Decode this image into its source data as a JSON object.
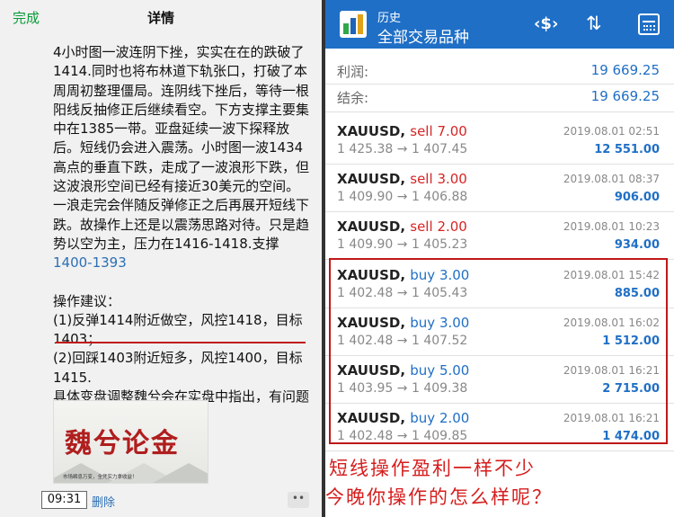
{
  "left_panel": {
    "header": {
      "done_label": "完成",
      "title": "详情"
    },
    "article": {
      "paragraph1_text": "4小时图一波连阴下挫，实实在在的跌破了1414.同时也将布林道下轨张口，打破了本周周初整理僵局。连阴线下挫后，等待一根阳线反抽修正后继续看空。下方支撑主要集中在1385一带。亚盘延续一波下探释放后。短线仍会进入震荡。小时图一波1434高点的垂直下跌，走成了一波浪形下跌，但这波浪形空间已经有接近30美元的空间。一浪走完会伴随反弹修正之后再展开短线下跌。故操作上还是以震荡思路对待。只是趋势以空为主，压力在1416-1418.支撑",
      "paragraph1_link": "1400-1393",
      "advice_title": "操作建议：",
      "advice1": "(1)反弹1414附近做空，风控1418，目标1403；",
      "advice2": "(2)回踩1403附近短多，风控1400，目标1415.",
      "footer_text": "具体变盘调整魏兮会在实盘中指出，有问题随时咨询🤝"
    },
    "banner": {
      "title": "魏兮论金",
      "subtitle": "市场瞬息万变，全凭实力拿收益！"
    },
    "time_badge": "09:31",
    "delete_label": "删除",
    "more_label": "••"
  },
  "right_panel": {
    "topbar": {
      "title_line1": "历史",
      "title_line2": "全部交易品种",
      "logo_icon": "mt4-logo-icon",
      "icons": [
        "currency-exchange-icon",
        "sort-icon",
        "calendar-icon"
      ],
      "accent_color": "#1f6fc6"
    },
    "summary": [
      {
        "label": "利润:",
        "value": "19 669.25"
      },
      {
        "label": "结余:",
        "value": "19 669.25"
      }
    ],
    "trades": [
      {
        "symbol": "XAUUSD,",
        "side": "sell",
        "lots": "7.00",
        "prices": "1 425.38 → 1 407.45",
        "date": "2019.08.01 02:51",
        "profit": "12 551.00"
      },
      {
        "symbol": "XAUUSD,",
        "side": "sell",
        "lots": "3.00",
        "prices": "1 409.90 → 1 406.88",
        "date": "2019.08.01 08:37",
        "profit": "906.00"
      },
      {
        "symbol": "XAUUSD,",
        "side": "sell",
        "lots": "2.00",
        "prices": "1 409.90 → 1 405.23",
        "date": "2019.08.01 10:23",
        "profit": "934.00"
      },
      {
        "symbol": "XAUUSD,",
        "side": "buy",
        "lots": "3.00",
        "prices": "1 402.48 → 1 405.43",
        "date": "2019.08.01 15:42",
        "profit": "885.00"
      },
      {
        "symbol": "XAUUSD,",
        "side": "buy",
        "lots": "3.00",
        "prices": "1 402.48 → 1 407.52",
        "date": "2019.08.01 16:02",
        "profit": "1 512.00"
      },
      {
        "symbol": "XAUUSD,",
        "side": "buy",
        "lots": "5.00",
        "prices": "1 403.95 → 1 409.38",
        "date": "2019.08.01 16:21",
        "profit": "2 715.00"
      },
      {
        "symbol": "XAUUSD,",
        "side": "buy",
        "lots": "2.00",
        "prices": "1 402.48 → 1 409.85",
        "date": "2019.08.01 16:21",
        "profit": "1 474.00"
      }
    ],
    "colors": {
      "sell": "#d62424",
      "buy": "#1f6fc6",
      "highlight_box": "#c01818"
    }
  },
  "caption": {
    "line1": "短线操作盈利一样不少",
    "line2": "今晚你操作的怎么样呢？",
    "color": "#d61d1d"
  }
}
